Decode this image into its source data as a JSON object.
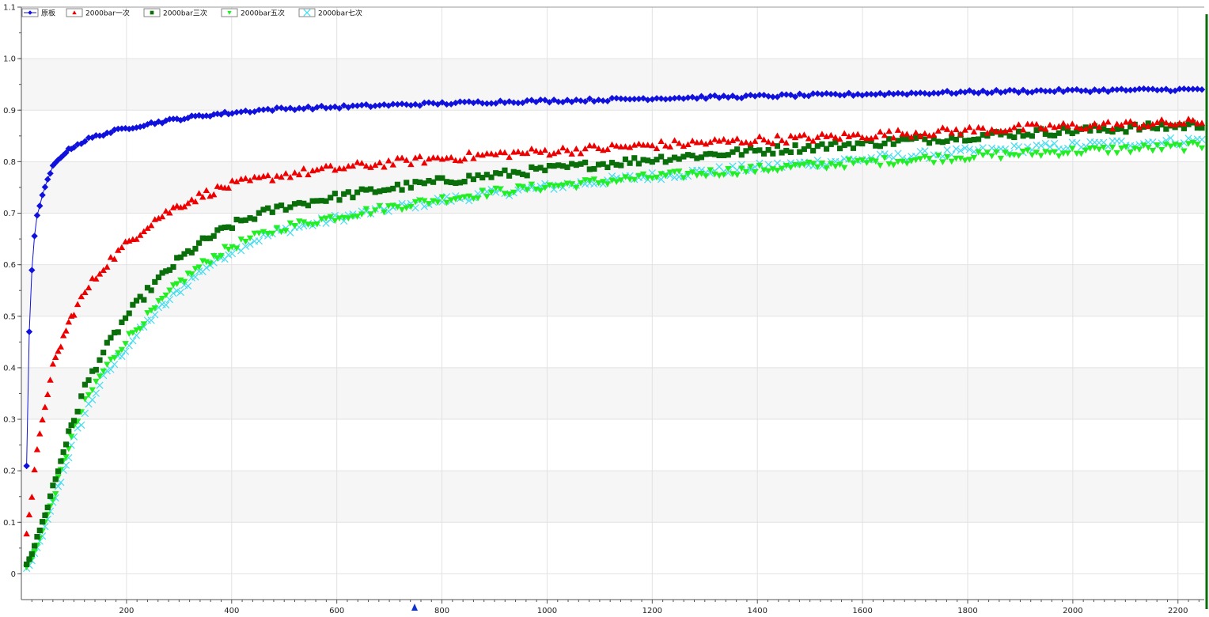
{
  "chart_data": {
    "type": "scatter",
    "title": "",
    "xlabel": "",
    "ylabel": "",
    "xlim": [
      0,
      2250
    ],
    "ylim": [
      -0.05,
      1.1
    ],
    "x_ticks": [
      200,
      400,
      600,
      800,
      1000,
      1200,
      1400,
      1600,
      1800,
      2000,
      2200
    ],
    "y_ticks": [
      0,
      0.1,
      0.2,
      0.3,
      0.4,
      0.5,
      0.6,
      0.7,
      0.8,
      0.9,
      1.0,
      1.1
    ],
    "x_tick_labels": [
      "200",
      "400",
      "600",
      "800",
      "1000",
      "1200",
      "1400",
      "1600",
      "1800",
      "2000",
      "2200"
    ],
    "y_tick_labels": [
      "0",
      "0.1",
      "0.2",
      "0.3",
      "0.4",
      "0.5",
      "0.6",
      "0.7",
      "0.8",
      "0.9",
      "1.0",
      "1.1"
    ],
    "grid": true,
    "legend_position": "top-left",
    "series": [
      {
        "name": "原板",
        "color": "#1111dd",
        "marker": "diamond",
        "line": true,
        "points": [
          [
            10,
            0.21
          ],
          [
            15,
            0.47
          ],
          [
            20,
            0.59
          ],
          [
            25,
            0.655
          ],
          [
            30,
            0.695
          ],
          [
            40,
            0.735
          ],
          [
            50,
            0.765
          ],
          [
            60,
            0.79
          ],
          [
            80,
            0.815
          ],
          [
            100,
            0.83
          ],
          [
            130,
            0.845
          ],
          [
            160,
            0.855
          ],
          [
            200,
            0.865
          ],
          [
            250,
            0.875
          ],
          [
            300,
            0.883
          ],
          [
            350,
            0.89
          ],
          [
            400,
            0.895
          ],
          [
            450,
            0.9
          ],
          [
            500,
            0.903
          ],
          [
            600,
            0.906
          ],
          [
            700,
            0.91
          ],
          [
            800,
            0.913
          ],
          [
            900,
            0.916
          ],
          [
            1000,
            0.918
          ],
          [
            1100,
            0.92
          ],
          [
            1200,
            0.923
          ],
          [
            1300,
            0.925
          ],
          [
            1400,
            0.927
          ],
          [
            1500,
            0.929
          ],
          [
            1600,
            0.931
          ],
          [
            1700,
            0.933
          ],
          [
            1800,
            0.935
          ],
          [
            1900,
            0.937
          ],
          [
            2000,
            0.938
          ],
          [
            2100,
            0.939
          ],
          [
            2200,
            0.94
          ],
          [
            2250,
            0.94
          ]
        ]
      },
      {
        "name": "2000bar一次",
        "color": "#ee0000",
        "marker": "triangle-up",
        "line": false,
        "points": [
          [
            10,
            0.08
          ],
          [
            20,
            0.15
          ],
          [
            25,
            0.2
          ],
          [
            30,
            0.24
          ],
          [
            40,
            0.3
          ],
          [
            50,
            0.35
          ],
          [
            60,
            0.4
          ],
          [
            80,
            0.46
          ],
          [
            100,
            0.51
          ],
          [
            130,
            0.56
          ],
          [
            160,
            0.6
          ],
          [
            200,
            0.64
          ],
          [
            250,
            0.685
          ],
          [
            300,
            0.715
          ],
          [
            350,
            0.738
          ],
          [
            400,
            0.755
          ],
          [
            450,
            0.765
          ],
          [
            500,
            0.775
          ],
          [
            600,
            0.787
          ],
          [
            700,
            0.798
          ],
          [
            800,
            0.807
          ],
          [
            900,
            0.814
          ],
          [
            1000,
            0.82
          ],
          [
            1100,
            0.826
          ],
          [
            1200,
            0.832
          ],
          [
            1300,
            0.837
          ],
          [
            1400,
            0.842
          ],
          [
            1500,
            0.846
          ],
          [
            1600,
            0.851
          ],
          [
            1700,
            0.856
          ],
          [
            1800,
            0.861
          ],
          [
            1900,
            0.865
          ],
          [
            2000,
            0.869
          ],
          [
            2100,
            0.872
          ],
          [
            2200,
            0.875
          ],
          [
            2250,
            0.876
          ]
        ]
      },
      {
        "name": "2000bar三次",
        "color": "#0a6e0a",
        "marker": "square",
        "line": false,
        "points": [
          [
            10,
            0.02
          ],
          [
            20,
            0.04
          ],
          [
            30,
            0.07
          ],
          [
            40,
            0.1
          ],
          [
            50,
            0.13
          ],
          [
            60,
            0.17
          ],
          [
            70,
            0.2
          ],
          [
            80,
            0.24
          ],
          [
            100,
            0.3
          ],
          [
            120,
            0.36
          ],
          [
            150,
            0.42
          ],
          [
            200,
            0.5
          ],
          [
            250,
            0.56
          ],
          [
            300,
            0.61
          ],
          [
            350,
            0.648
          ],
          [
            400,
            0.676
          ],
          [
            450,
            0.697
          ],
          [
            500,
            0.713
          ],
          [
            600,
            0.732
          ],
          [
            700,
            0.748
          ],
          [
            800,
            0.762
          ],
          [
            900,
            0.774
          ],
          [
            1000,
            0.785
          ],
          [
            1100,
            0.795
          ],
          [
            1200,
            0.805
          ],
          [
            1300,
            0.813
          ],
          [
            1400,
            0.821
          ],
          [
            1500,
            0.828
          ],
          [
            1600,
            0.835
          ],
          [
            1700,
            0.842
          ],
          [
            1800,
            0.849
          ],
          [
            1900,
            0.855
          ],
          [
            2000,
            0.86
          ],
          [
            2100,
            0.865
          ],
          [
            2200,
            0.869
          ],
          [
            2250,
            0.871
          ]
        ]
      },
      {
        "name": "2000bar五次",
        "color": "#22ee22",
        "marker": "triangle-down",
        "line": false,
        "points": [
          [
            10,
            0.015
          ],
          [
            20,
            0.03
          ],
          [
            30,
            0.055
          ],
          [
            40,
            0.085
          ],
          [
            50,
            0.115
          ],
          [
            60,
            0.145
          ],
          [
            70,
            0.18
          ],
          [
            80,
            0.215
          ],
          [
            100,
            0.28
          ],
          [
            120,
            0.33
          ],
          [
            150,
            0.385
          ],
          [
            200,
            0.455
          ],
          [
            250,
            0.51
          ],
          [
            300,
            0.565
          ],
          [
            350,
            0.605
          ],
          [
            400,
            0.635
          ],
          [
            450,
            0.656
          ],
          [
            500,
            0.673
          ],
          [
            600,
            0.693
          ],
          [
            700,
            0.711
          ],
          [
            800,
            0.727
          ],
          [
            900,
            0.741
          ],
          [
            1000,
            0.752
          ],
          [
            1100,
            0.761
          ],
          [
            1200,
            0.77
          ],
          [
            1300,
            0.778
          ],
          [
            1400,
            0.785
          ],
          [
            1500,
            0.792
          ],
          [
            1600,
            0.798
          ],
          [
            1700,
            0.804
          ],
          [
            1800,
            0.81
          ],
          [
            1900,
            0.815
          ],
          [
            2000,
            0.82
          ],
          [
            2100,
            0.824
          ],
          [
            2200,
            0.828
          ],
          [
            2250,
            0.83
          ]
        ]
      },
      {
        "name": "2000bar七次",
        "color": "#44ddee",
        "marker": "x",
        "line": false,
        "points": [
          [
            10,
            0.01
          ],
          [
            20,
            0.025
          ],
          [
            30,
            0.05
          ],
          [
            40,
            0.075
          ],
          [
            50,
            0.105
          ],
          [
            60,
            0.135
          ],
          [
            70,
            0.165
          ],
          [
            80,
            0.2
          ],
          [
            100,
            0.26
          ],
          [
            120,
            0.31
          ],
          [
            150,
            0.37
          ],
          [
            200,
            0.44
          ],
          [
            250,
            0.5
          ],
          [
            300,
            0.55
          ],
          [
            350,
            0.595
          ],
          [
            400,
            0.627
          ],
          [
            450,
            0.65
          ],
          [
            500,
            0.667
          ],
          [
            600,
            0.69
          ],
          [
            700,
            0.709
          ],
          [
            800,
            0.725
          ],
          [
            900,
            0.739
          ],
          [
            1000,
            0.751
          ],
          [
            1100,
            0.762
          ],
          [
            1200,
            0.772
          ],
          [
            1300,
            0.781
          ],
          [
            1400,
            0.789
          ],
          [
            1500,
            0.797
          ],
          [
            1600,
            0.805
          ],
          [
            1700,
            0.812
          ],
          [
            1800,
            0.819
          ],
          [
            1900,
            0.825
          ],
          [
            2000,
            0.831
          ],
          [
            2100,
            0.836
          ],
          [
            2200,
            0.84
          ],
          [
            2250,
            0.842
          ]
        ]
      }
    ]
  }
}
